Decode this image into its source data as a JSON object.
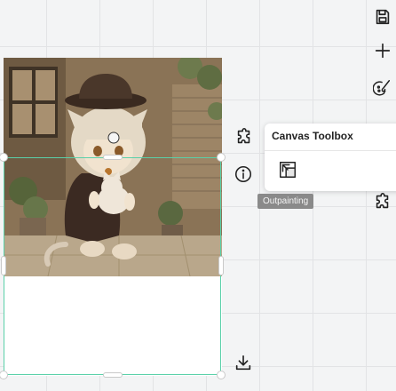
{
  "toolbar": {
    "save_icon": "save-icon",
    "add_icon": "plus-icon",
    "brush_icon": "brush-palette-icon"
  },
  "side_icons": {
    "puzzle_top": "puzzle-icon",
    "info": "info-icon",
    "puzzle_right": "puzzle-icon",
    "download": "download-icon"
  },
  "toolbox": {
    "title": "Canvas Toolbox",
    "outpainting_icon": "expand-frame-icon",
    "tooltip": "Outpainting"
  },
  "colors": {
    "selection": "#5ad0a9",
    "tooltip_bg": "#8a8a8a",
    "canvas_bg": "#f3f4f5"
  }
}
